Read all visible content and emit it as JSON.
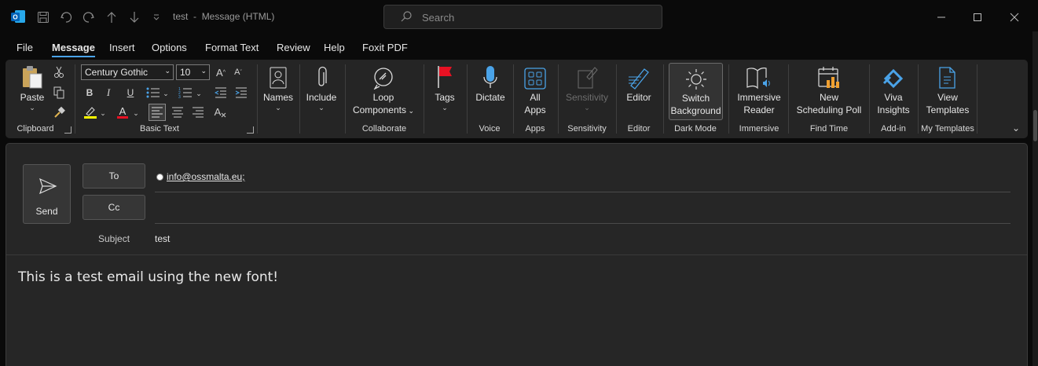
{
  "title": {
    "subject": "test",
    "separator": "-",
    "window": "Message (HTML)"
  },
  "search": {
    "placeholder": "Search"
  },
  "menu": [
    "File",
    "Message",
    "Insert",
    "Options",
    "Format Text",
    "Review",
    "Help",
    "Foxit PDF"
  ],
  "menu_active": "Message",
  "ribbon": {
    "paste": "Paste",
    "font_name": "Century Gothic",
    "font_size": "10",
    "names": "Names",
    "include": "Include",
    "loop_line1": "Loop",
    "loop_line2": "Components",
    "tags": "Tags",
    "dictate": "Dictate",
    "all_apps_line1": "All",
    "all_apps_line2": "Apps",
    "sensitivity": "Sensitivity",
    "editor": "Editor",
    "switch_line1": "Switch",
    "switch_line2": "Background",
    "immersive_line1": "Immersive",
    "immersive_line2": "Reader",
    "sched_line1": "New",
    "sched_line2": "Scheduling Poll",
    "viva_line1": "Viva",
    "viva_line2": "Insights",
    "templates_line1": "View",
    "templates_line2": "Templates",
    "groups": {
      "clipboard": "Clipboard",
      "basic_text": "Basic Text",
      "collaborate": "Collaborate",
      "voice": "Voice",
      "apps": "Apps",
      "sensitivity": "Sensitivity",
      "editor": "Editor",
      "dark_mode": "Dark Mode",
      "immersive": "Immersive",
      "find_time": "Find Time",
      "add_in": "Add-in",
      "my_templates": "My Templates"
    }
  },
  "compose": {
    "send": "Send",
    "to": "To",
    "cc": "Cc",
    "recipient": "info@ossmalta.eu;",
    "subject_label": "Subject",
    "subject_value": "test",
    "body": "This is a test email using the new font!"
  },
  "colors": {
    "accent": "#4aa3e8",
    "highlight": "#ffff00",
    "font_color": "#e81123",
    "tag_flag": "#e81123"
  }
}
